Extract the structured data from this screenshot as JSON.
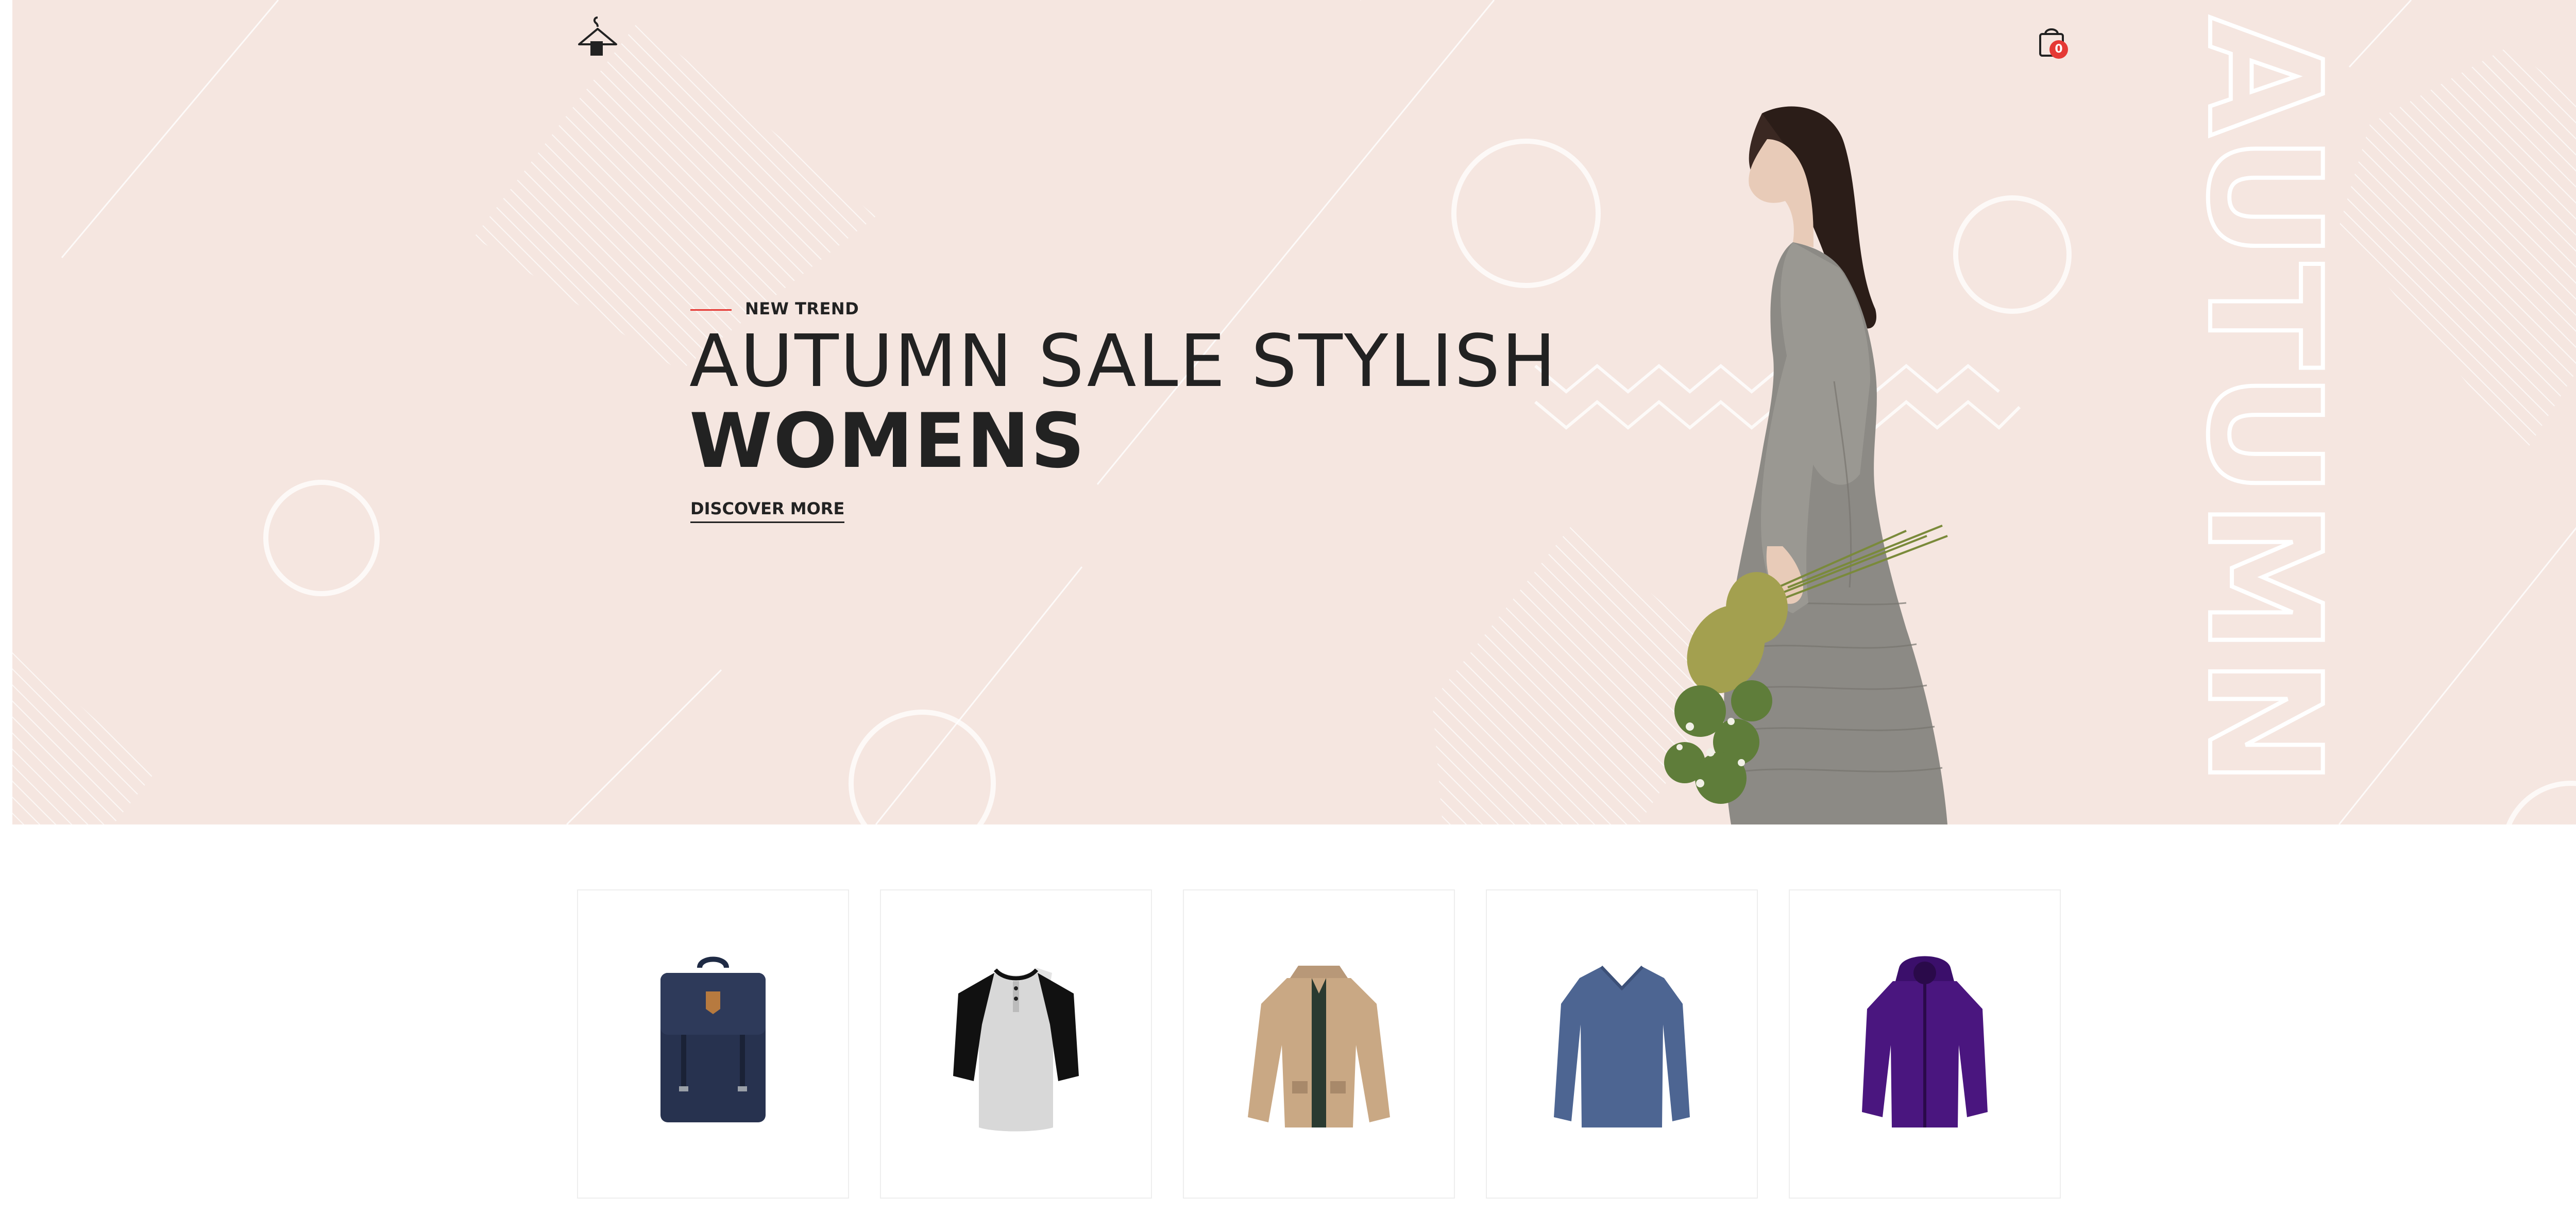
{
  "header": {
    "logo_icon": "hanger-bag-icon",
    "cart_icon": "shopping-bag-icon",
    "cart_count": "0"
  },
  "hero": {
    "eyebrow": "NEW TREND",
    "headline": "AUTUMN SALE STYLISH",
    "headline_bold": "WOMENS",
    "cta": "DISCOVER MORE",
    "vertical_word": "AUTUMN",
    "image": "woman-with-flowers",
    "colors": {
      "background": "#f5e6e0",
      "accent": "#e53935",
      "text": "#222222"
    }
  },
  "products": [
    {
      "image": "navy-backpack"
    },
    {
      "image": "raglan-henley-shirt"
    },
    {
      "image": "khaki-jacket"
    },
    {
      "image": "blue-longsleeve-shirt"
    },
    {
      "image": "purple-hooded-jacket"
    }
  ]
}
